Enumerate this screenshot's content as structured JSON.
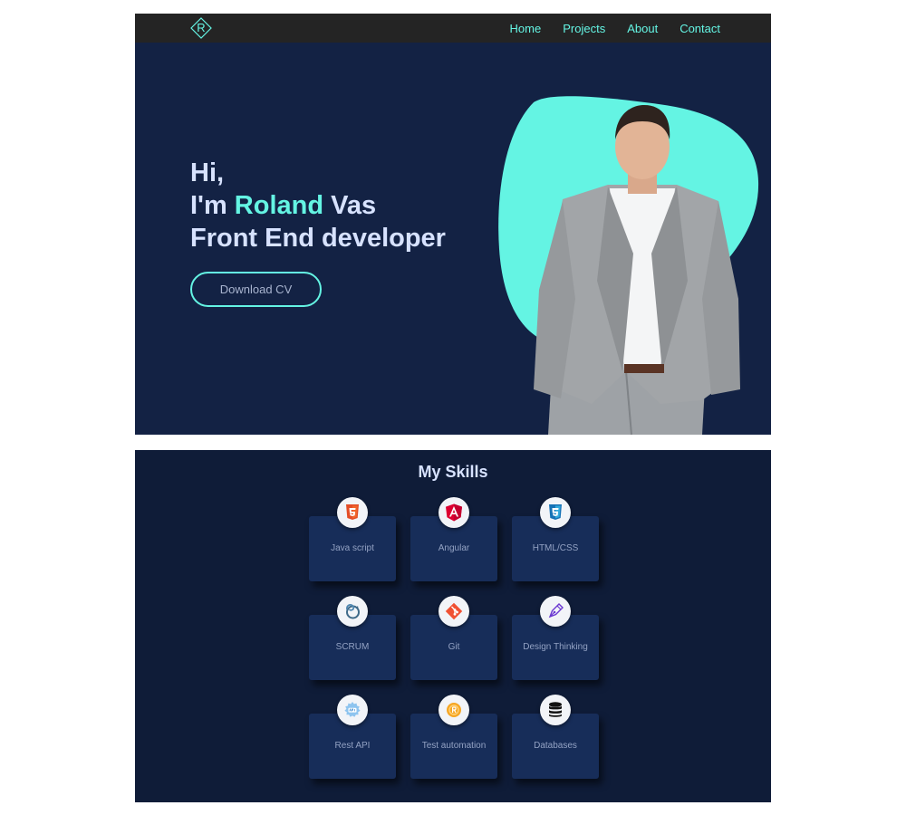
{
  "nav": {
    "logo_letter": "R",
    "links": [
      "Home",
      "Projects",
      "About",
      "Contact"
    ]
  },
  "hero": {
    "line1": "Hi,",
    "line2_prefix": "I'm ",
    "first_name": "Roland",
    "last_name": " Vas",
    "line3": "Front End developer",
    "cv_button": "Download CV"
  },
  "skills": {
    "title": "My Skills",
    "items": [
      {
        "label": "Java script",
        "icon": "html5-icon"
      },
      {
        "label": "Angular",
        "icon": "angular-icon"
      },
      {
        "label": "HTML/CSS",
        "icon": "css3-icon"
      },
      {
        "label": "SCRUM",
        "icon": "scrum-icon"
      },
      {
        "label": "Git",
        "icon": "git-icon"
      },
      {
        "label": "Design Thinking",
        "icon": "pen-nib-icon"
      },
      {
        "label": "Rest API",
        "icon": "api-icon"
      },
      {
        "label": "Test automation",
        "icon": "automation-icon"
      },
      {
        "label": "Databases",
        "icon": "database-icon"
      }
    ]
  },
  "colors": {
    "accent": "#64f4e3",
    "hero_bg": "#132244",
    "nav_bg": "#242424",
    "skills_bg": "#0f1c38",
    "card_bg": "#172d59",
    "headline": "#d7e2ff"
  }
}
